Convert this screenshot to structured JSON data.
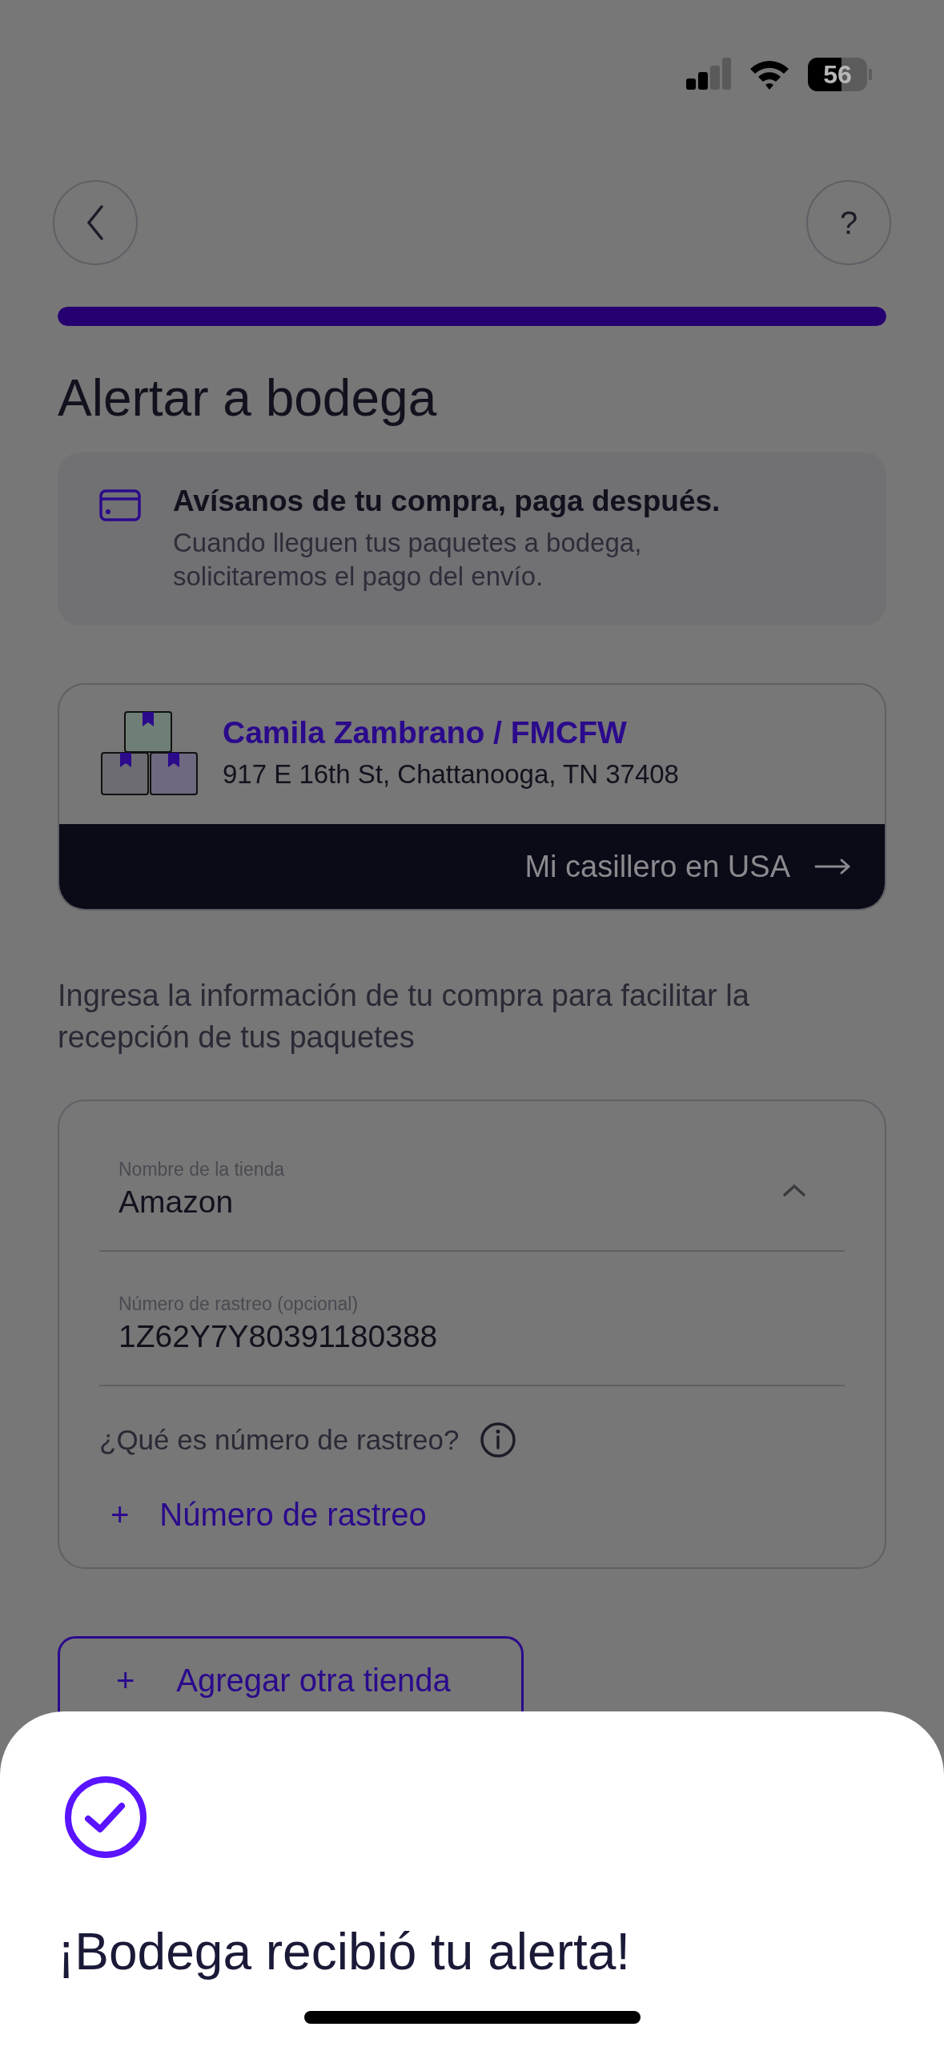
{
  "status_bar": {
    "battery": "56"
  },
  "header": {
    "help": "?"
  },
  "progress": {
    "level": 1
  },
  "title": "Alertar a bodega",
  "notice": {
    "title": "Avísanos de tu compra, paga después.",
    "text": "Cuando lleguen tus paquetes a bodega, solicitaremos el pago del envío."
  },
  "locker": {
    "name": "Camila Zambrano / FMCFW",
    "address": "917 E 16th St, Chattanooga, TN 37408",
    "link": "Mi casillero en USA"
  },
  "instructions": "Ingresa la información de tu compra para facilitar la recepción de tus paquetes",
  "store_form": {
    "fields": [
      {
        "kind": "dropdown",
        "label": "Nombre de la tienda",
        "value": "Amazon",
        "expanded": true
      },
      {
        "kind": "text",
        "label": "Número de rastreo (opcional)",
        "value": "1Z62Y7Y80391180388"
      }
    ],
    "help_link": "¿Qué es número de rastreo?",
    "add_tracking": {
      "icon": "+",
      "label": "Número de rastreo"
    }
  },
  "add_store": {
    "icon": "+",
    "label": "Agregar otra tienda"
  },
  "sheet": {
    "title": "¡Bodega recibió tu alerta!"
  }
}
